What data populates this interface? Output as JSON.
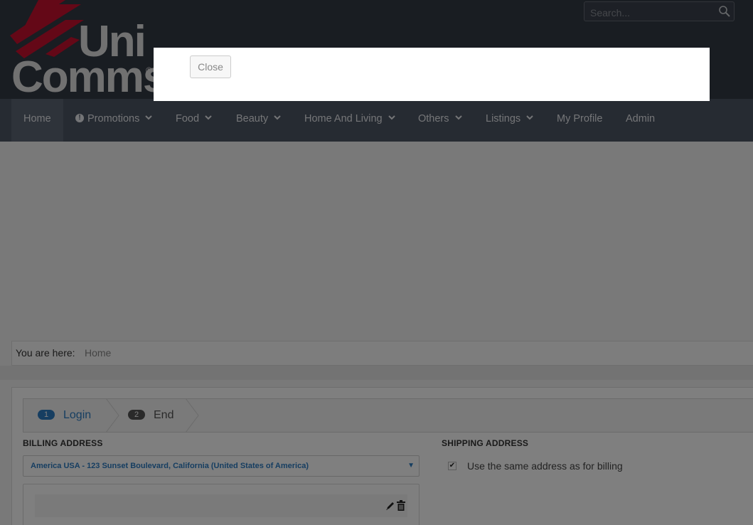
{
  "header": {
    "logo_line1": "Uni",
    "logo_line2": "Comms",
    "logo_mark": "®",
    "search": {
      "placeholder": "Search..."
    }
  },
  "nav": {
    "items": [
      {
        "label": "Home",
        "active": true,
        "dropdown": false
      },
      {
        "label": "Promotions",
        "dropdown": true,
        "icon": "exclamation-icon"
      },
      {
        "label": "Food",
        "dropdown": true
      },
      {
        "label": "Beauty",
        "dropdown": true
      },
      {
        "label": "Home And Living",
        "dropdown": true
      },
      {
        "label": "Others",
        "dropdown": true
      },
      {
        "label": "Listings",
        "dropdown": true
      },
      {
        "label": "My Profile",
        "dropdown": false
      },
      {
        "label": "Admin",
        "dropdown": false
      }
    ]
  },
  "breadcrumb": {
    "label": "You are here:",
    "current": "Home"
  },
  "steps": [
    {
      "number": "1",
      "label": "Login",
      "active": true
    },
    {
      "number": "2",
      "label": "End",
      "active": false
    }
  ],
  "billing": {
    "title": "BILLING ADDRESS",
    "selected_address": "America USA - 123 Sunset Boulevard, California (United States of America)"
  },
  "shipping": {
    "title": "SHIPPING ADDRESS",
    "same_as_billing_label": "Use the same address as for billing",
    "same_as_billing_checked": true
  },
  "modal": {
    "close_label": "Close"
  },
  "colors": {
    "header_bg": "#333a45",
    "nav_bg": "#4d5665",
    "logo_red": "#c8102e",
    "accent_blue": "#2d7cc3"
  }
}
